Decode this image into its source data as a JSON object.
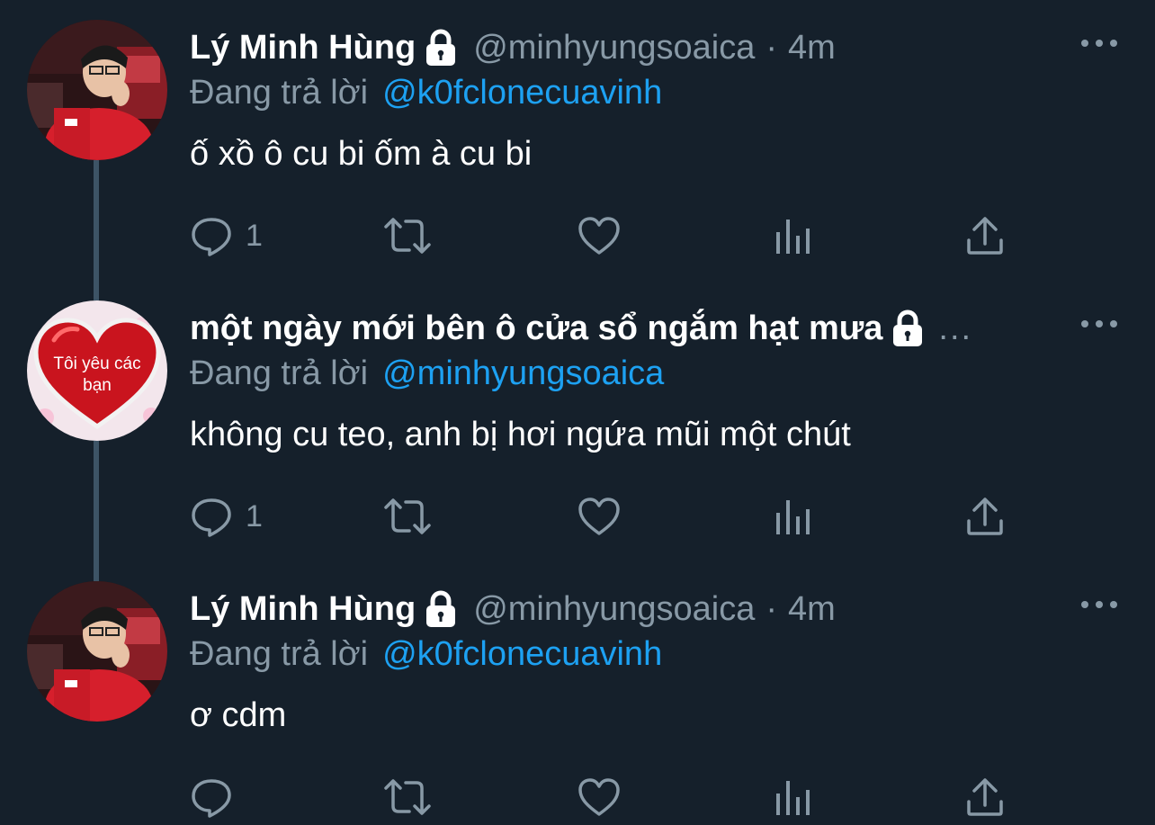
{
  "colors": {
    "background": "#15202b",
    "secondary_text": "#8899a6",
    "link": "#1da1f2",
    "thread_line": "#3d5466"
  },
  "tweets": [
    {
      "display_name": "Lý Minh Hùng",
      "handle": "@minhyungsoaica",
      "separator": "·",
      "time": "4m",
      "reply_prefix": "Đang trả lời",
      "reply_to": "@k0fclonecuavinh",
      "text": "ố xồ ô cu bi ốm à cu bi",
      "reply_count": "1",
      "protected_icon": "lock-icon",
      "avatar": "photo"
    },
    {
      "display_name": "một ngày mới bên ô cửa sổ ngắm hạt mưa",
      "handle_truncated": "...",
      "reply_prefix": "Đang trả lời",
      "reply_to": "@minhyungsoaica",
      "text": "không cu teo, anh bị hơi ngứa mũi một chút",
      "reply_count": "1",
      "protected_icon": "lock-icon",
      "avatar": "heart",
      "avatar_text_line1": "Tôi yêu các",
      "avatar_text_line2": "bạn"
    },
    {
      "display_name": "Lý Minh Hùng",
      "handle": "@minhyungsoaica",
      "separator": "·",
      "time": "4m",
      "reply_prefix": "Đang trả lời",
      "reply_to": "@k0fclonecuavinh",
      "text": "ơ cdm",
      "reply_count": "",
      "protected_icon": "lock-icon",
      "avatar": "photo"
    }
  ],
  "action_icons": [
    "reply-icon",
    "retweet-icon",
    "like-icon",
    "analytics-icon",
    "share-icon"
  ]
}
